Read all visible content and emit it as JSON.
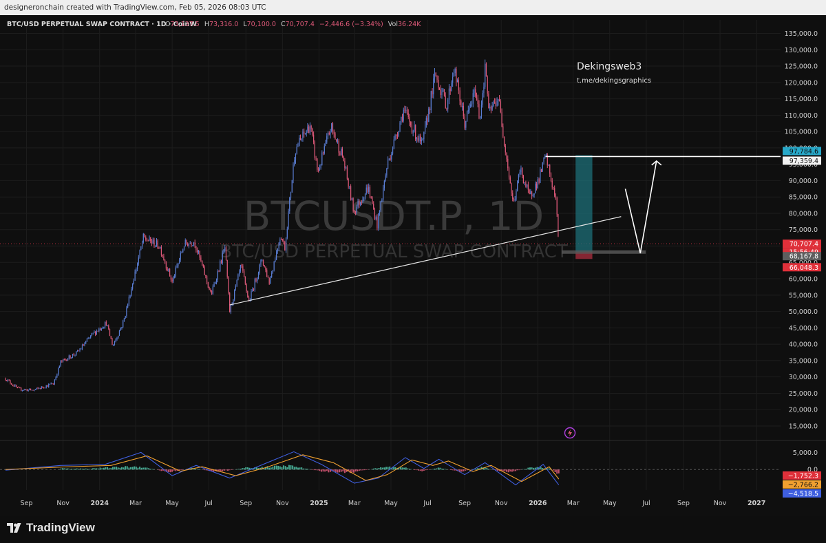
{
  "header": {
    "credit": "designeronchain created with TradingView.com, Feb 05, 2026 08:03 UTC"
  },
  "symbol_info": {
    "title": "BTC/USD PERPETUAL SWAP CONTRACT · 1D · CoinW",
    "open_label": "O",
    "open": "73,137.5",
    "high_label": "H",
    "high": "73,316.0",
    "low_label": "L",
    "low": "70,100.0",
    "close_label": "C",
    "close": "70,707.4",
    "change": "−2,446.6 (−3.34%)",
    "vol_label": "Vol",
    "vol": "36.24K"
  },
  "watermark": {
    "symbol": "BTCUSDT.P, 1D",
    "description": "BTC/USD PERPETUAL SWAP CONTRACT"
  },
  "annotations": {
    "author": "Dekingsweb3",
    "link": "t.me/dekingsgraphics"
  },
  "price_tags": {
    "target": "97,784.6",
    "level": "97,359.4",
    "last": "70,707.4",
    "countdown": "15:56:49",
    "entry": "68,167.8",
    "stop": "66,048.3"
  },
  "osc_tags": {
    "a": "−1,752.3",
    "b": "−2,766.2",
    "c": "−4,518.5"
  },
  "footer": {
    "brand": "TradingView"
  },
  "colors": {
    "up": "#5b7fd6",
    "down": "#e05a7a",
    "grid": "#1d1d1d",
    "axis_text": "#d0d0d0",
    "target_zone": "#1e6f78",
    "stop_zone": "#9a2a3a",
    "last_tag": "#e0303a",
    "target_tag": "#27a8c9",
    "macd_line": "#3f5fe0",
    "signal_line": "#f0a030"
  },
  "chart_data": [
    {
      "type": "candlestick",
      "title": "BTC/USD PERPETUAL SWAP CONTRACT · 1D · CoinW",
      "x_ticks": [
        "Sep",
        "Nov",
        "2024",
        "Mar",
        "May",
        "Jul",
        "Sep",
        "Nov",
        "2025",
        "Mar",
        "May",
        "Jul",
        "Sep",
        "Nov",
        "2026",
        "Mar",
        "May",
        "Jul",
        "Sep",
        "Nov",
        "2027"
      ],
      "y_ticks": [
        "15,000.0",
        "20,000.0",
        "25,000.0",
        "30,000.0",
        "35,000.0",
        "40,000.0",
        "45,000.0",
        "50,000.0",
        "55,000.0",
        "60,000.0",
        "65,000.0",
        "70,000.0",
        "75,000.0",
        "80,000.0",
        "85,000.0",
        "90,000.0",
        "95,000.0",
        "100,000.0",
        "105,000.0",
        "110,000.0",
        "115,000.0",
        "120,000.0",
        "125,000.0",
        "130,000.0",
        "135,000.0"
      ],
      "ylim": [
        11000,
        137000
      ],
      "x_range": [
        "2023-07-28",
        "2027-02-10"
      ],
      "price_path": [
        [
          "2023-07-28",
          29500
        ],
        [
          "2023-08-18",
          26300
        ],
        [
          "2023-09-12",
          25900
        ],
        [
          "2023-10-16",
          28000
        ],
        [
          "2023-10-28",
          34500
        ],
        [
          "2023-11-25",
          37500
        ],
        [
          "2023-12-20",
          43000
        ],
        [
          "2024-01-12",
          46500
        ],
        [
          "2024-01-23",
          39500
        ],
        [
          "2024-02-10",
          47000
        ],
        [
          "2024-02-28",
          61000
        ],
        [
          "2024-03-14",
          72500
        ],
        [
          "2024-04-10",
          70000
        ],
        [
          "2024-05-01",
          59000
        ],
        [
          "2024-05-21",
          70500
        ],
        [
          "2024-06-07",
          71500
        ],
        [
          "2024-07-05",
          55000
        ],
        [
          "2024-07-28",
          69500
        ],
        [
          "2024-08-05",
          50000
        ],
        [
          "2024-08-24",
          64000
        ],
        [
          "2024-09-06",
          53000
        ],
        [
          "2024-09-28",
          66000
        ],
        [
          "2024-10-10",
          59000
        ],
        [
          "2024-10-29",
          73500
        ],
        [
          "2024-11-05",
          69500
        ],
        [
          "2024-11-22",
          99500
        ],
        [
          "2024-12-17",
          107000
        ],
        [
          "2024-12-30",
          92500
        ],
        [
          "2025-01-21",
          106500
        ],
        [
          "2025-02-10",
          97000
        ],
        [
          "2025-02-28",
          80500
        ],
        [
          "2025-03-24",
          88000
        ],
        [
          "2025-04-08",
          76500
        ],
        [
          "2025-04-25",
          95000
        ],
        [
          "2025-05-22",
          111500
        ],
        [
          "2025-06-22",
          100500
        ],
        [
          "2025-07-14",
          122500
        ],
        [
          "2025-08-02",
          113000
        ],
        [
          "2025-08-14",
          124500
        ],
        [
          "2025-09-01",
          107500
        ],
        [
          "2025-09-19",
          117500
        ],
        [
          "2025-09-26",
          109000
        ],
        [
          "2025-10-06",
          125500
        ],
        [
          "2025-10-11",
          110500
        ],
        [
          "2025-10-27",
          115500
        ],
        [
          "2025-11-21",
          82500
        ],
        [
          "2025-12-03",
          93500
        ],
        [
          "2025-12-18",
          85000
        ],
        [
          "2026-01-02",
          90000
        ],
        [
          "2026-01-14",
          97500
        ],
        [
          "2026-01-31",
          84000
        ],
        [
          "2026-02-05",
          70707
        ]
      ],
      "levels": {
        "top_line": 97359.4,
        "target": 97784.6,
        "last": 70707.4,
        "entry": 68167.8,
        "stop": 66048.3
      },
      "position_box": {
        "start": "2026-03-05",
        "end": "2026-04-02",
        "target": 97784.6,
        "entry": 68167.8,
        "stop": 66048.3
      },
      "trendline": [
        [
          "2024-08-05",
          52000
        ],
        [
          "2026-05-20",
          79000
        ]
      ],
      "projection": [
        [
          "2026-05-27",
          87500
        ],
        [
          "2026-06-21",
          67800
        ],
        [
          "2026-07-18",
          96000
        ]
      ],
      "target_line": {
        "start": "2026-01-14",
        "end": "2027-02-10",
        "value": 97359.4
      }
    },
    {
      "type": "line",
      "title": "",
      "y_ticks": [
        "0.0",
        "5,000.0"
      ],
      "ylim": [
        -6000,
        7500
      ],
      "series": [
        {
          "kind": "line",
          "color": "#3f5fe0",
          "points": [
            [
              "2023-07-28",
              -200
            ],
            [
              "2023-10-28",
              1200
            ],
            [
              "2024-01-10",
              1500
            ],
            [
              "2024-03-10",
              5000
            ],
            [
              "2024-05-01",
              -1800
            ],
            [
              "2024-06-10",
              1200
            ],
            [
              "2024-08-05",
              -2500
            ],
            [
              "2024-09-20",
              800
            ],
            [
              "2024-11-20",
              5200
            ],
            [
              "2025-01-05",
              1500
            ],
            [
              "2025-03-01",
              -4000
            ],
            [
              "2025-04-10",
              -2500
            ],
            [
              "2025-05-25",
              3500
            ],
            [
              "2025-06-25",
              300
            ],
            [
              "2025-07-20",
              3000
            ],
            [
              "2025-09-01",
              -1500
            ],
            [
              "2025-10-05",
              2000
            ],
            [
              "2025-11-25",
              -4500
            ],
            [
              "2026-01-10",
              1500
            ],
            [
              "2026-02-05",
              -4500
            ]
          ]
        },
        {
          "kind": "line",
          "color": "#f0a030",
          "points": [
            [
              "2023-07-28",
              0
            ],
            [
              "2023-11-10",
              800
            ],
            [
              "2024-01-20",
              1200
            ],
            [
              "2024-03-20",
              4000
            ],
            [
              "2024-05-15",
              -500
            ],
            [
              "2024-06-20",
              800
            ],
            [
              "2024-08-15",
              -1800
            ],
            [
              "2024-10-05",
              600
            ],
            [
              "2024-12-05",
              4300
            ],
            [
              "2025-01-25",
              2000
            ],
            [
              "2025-03-20",
              -3200
            ],
            [
              "2025-04-25",
              -1500
            ],
            [
              "2025-06-05",
              2800
            ],
            [
              "2025-07-10",
              1200
            ],
            [
              "2025-08-05",
              2500
            ],
            [
              "2025-09-15",
              -600
            ],
            [
              "2025-10-15",
              1200
            ],
            [
              "2025-12-05",
              -3500
            ],
            [
              "2026-01-20",
              800
            ],
            [
              "2026-02-05",
              -2800
            ]
          ]
        },
        {
          "kind": "histogram",
          "points": [
            [
              "2023-10-28",
              400
            ],
            [
              "2023-12-10",
              300
            ],
            [
              "2024-02-20",
              1000
            ],
            [
              "2024-03-10",
              1000
            ],
            [
              "2024-04-25",
              -900
            ],
            [
              "2024-06-05",
              500
            ],
            [
              "2024-07-15",
              -900
            ],
            [
              "2024-09-01",
              600
            ],
            [
              "2024-11-15",
              1300
            ],
            [
              "2025-01-05",
              -700
            ],
            [
              "2025-02-25",
              -1000
            ],
            [
              "2025-04-20",
              900
            ],
            [
              "2025-05-25",
              700
            ],
            [
              "2025-06-20",
              -700
            ],
            [
              "2025-07-20",
              600
            ],
            [
              "2025-08-25",
              -800
            ],
            [
              "2025-10-01",
              800
            ],
            [
              "2025-11-10",
              -1100
            ],
            [
              "2025-12-25",
              900
            ],
            [
              "2026-01-20",
              500
            ],
            [
              "2026-02-05",
              -1752
            ]
          ]
        }
      ]
    }
  ]
}
